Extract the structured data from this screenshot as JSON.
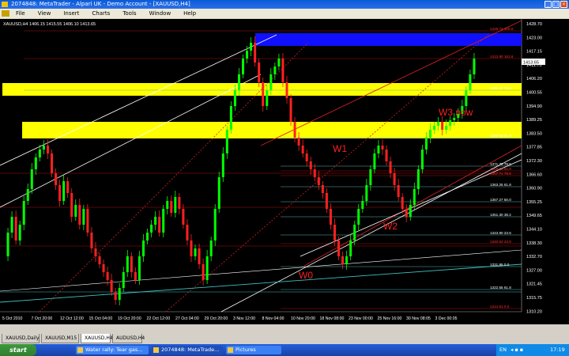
{
  "window": {
    "title": "2074848: MetaTrader - Alpari UK - Demo Account - [XAUUSD,H4]"
  },
  "menu": [
    "File",
    "View",
    "Insert",
    "Charts",
    "Tools",
    "Window",
    "Help"
  ],
  "chart": {
    "header": "XAUUSD,H4  1406.15 1415.55 1406.10 1413.65",
    "price_labels": [
      "1428.70",
      "1423.00",
      "1417.15",
      "1411.75",
      "1406.20",
      "1400.55",
      "1394.90",
      "1389.25",
      "1383.50",
      "1377.85",
      "1372.30",
      "1366.60",
      "1360.90",
      "1355.25",
      "1349.65",
      "1344.10",
      "1338.30",
      "1332.70",
      "1327.00",
      "1321.45",
      "1315.75",
      "1310.20"
    ],
    "current_price": "1413.65",
    "date_labels": [
      "5 Oct 2010",
      "7 Oct 20:00",
      "12 Oct 12:00",
      "15 Oct 04:00",
      "19 Oct 20:00",
      "22 Oct 12:00",
      "27 Oct 04:00",
      "29 Oct 20:00",
      "3 Nov 12:00",
      "8 Nov 04:00",
      "10 Nov 20:00",
      "18 Nov 08:00",
      "23 Nov 00:00",
      "25 Nov 16:00",
      "30 Nov 08:05",
      "3 Dec 00:05"
    ],
    "fib_labels": [
      "1425.74 100.0",
      "1413.90 161.8",
      "1401.57 78.5",
      "1385.56 61.8",
      "1371.76 78.5",
      "1369.82 61.8",
      "1367.71 78.6",
      "1363.25 61.8",
      "1357.27 50.0",
      "1351.30 38.2",
      "1343.90 23.6",
      "1340.63 23.6",
      "1331.95 0.0",
      "1322.55 61.8",
      "1314.61 0.0"
    ],
    "annotations": {
      "w0": "W0",
      "w1": "W1",
      "w2": "W2",
      "w3": "W3 now"
    }
  },
  "tabs": [
    "XAUUSD,Daily",
    "XAUUSD,M15",
    "XAUUSD,H4",
    "AUDUSD,H4"
  ],
  "active_tab": "XAUUSD,H4",
  "taskbar": {
    "start": "start",
    "items": [
      "Water rally: Tear gas...",
      "2074848: MetaTrade...",
      "Pictures"
    ],
    "lang": "EN",
    "clock": "17:19"
  },
  "colors": {
    "bull": "#00ff00",
    "bear": "#ff2020",
    "zone_yellow": "#ffff00",
    "zone_blue": "#1010ff",
    "annotation": "#ff2020"
  }
}
